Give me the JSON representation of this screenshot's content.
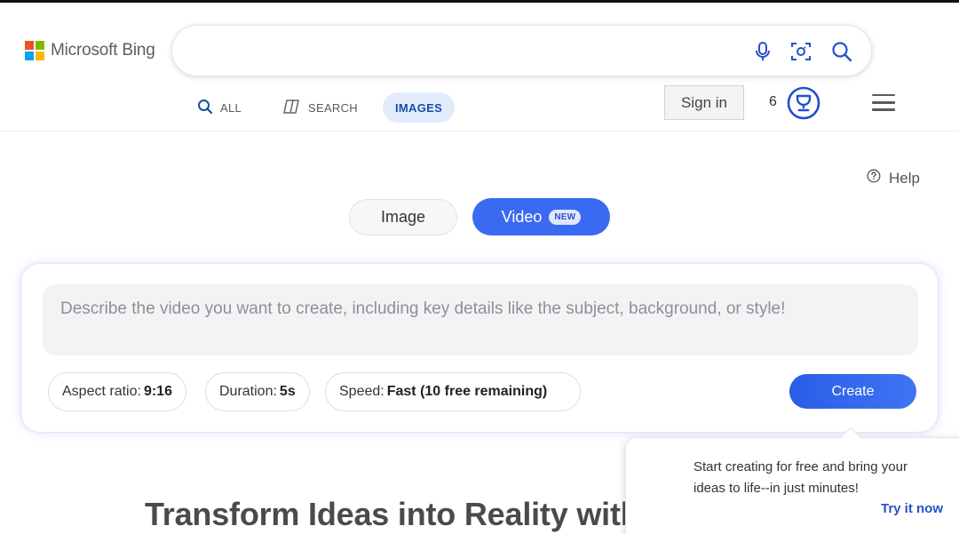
{
  "header": {
    "logo_text": "Microsoft Bing",
    "logo_colors": [
      "#f25022",
      "#7fba00",
      "#00a4ef",
      "#ffb900"
    ],
    "search": {
      "value": "",
      "placeholder": ""
    },
    "tabs": [
      {
        "label": "ALL",
        "icon": "search-icon"
      },
      {
        "label": "SEARCH",
        "icon": "copilot-search-icon"
      },
      {
        "label": "IMAGES",
        "active": true
      }
    ],
    "sign_in_label": "Sign in",
    "reward_points": "6"
  },
  "help_label": "Help",
  "mode_toggle": {
    "image_label": "Image",
    "video_label": "Video",
    "video_badge": "NEW",
    "selected": "Video"
  },
  "creator": {
    "prompt_placeholder": "Describe the video you want to create, including key details like the subject, background, or style!",
    "options": {
      "aspect_label": "Aspect ratio:",
      "aspect_value": "9:16",
      "duration_label": "Duration:",
      "duration_value": "5s",
      "speed_label": "Speed:",
      "speed_value": "Fast (10 free remaining)"
    },
    "create_label": "Create"
  },
  "headline": "Transform Ideas into Reality with",
  "popover": {
    "message": "Start creating for free and bring your ideas to life--in just minutes!",
    "link_label": "Try it now"
  },
  "colors": {
    "accent": "#3a6af2",
    "link": "#2451c9",
    "active_tab_bg": "#e2ebfb",
    "reward_ring": "#1f4fd1"
  }
}
